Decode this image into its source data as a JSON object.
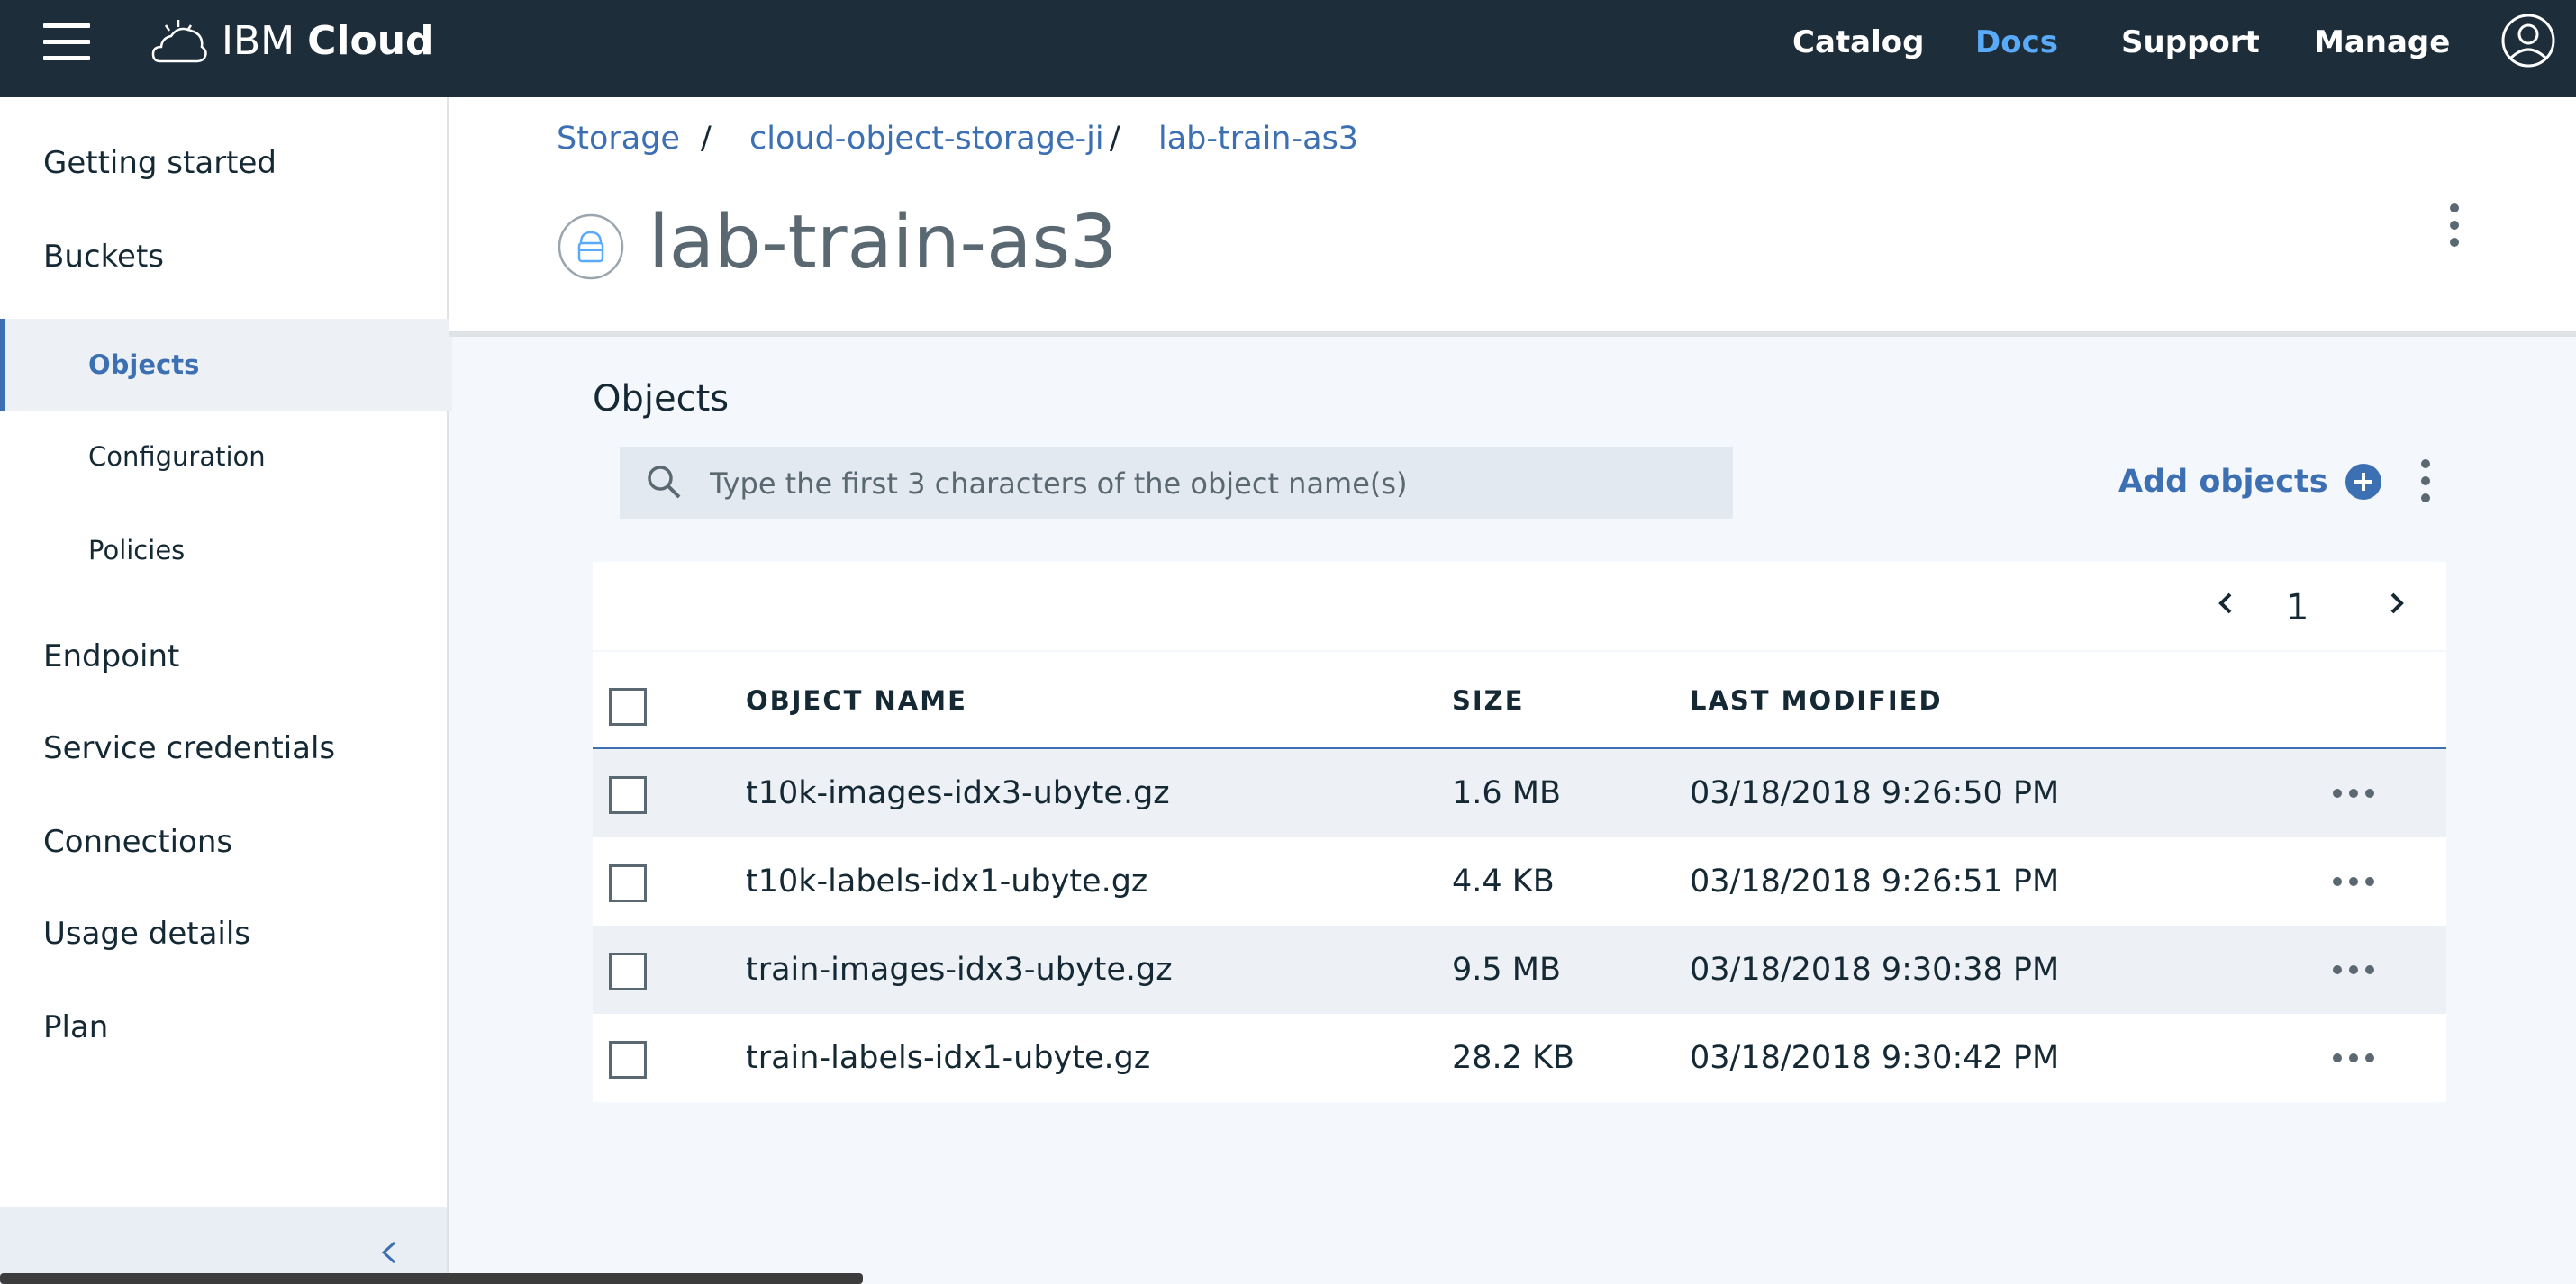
{
  "topbar": {
    "brand_prefix": "IBM",
    "brand_suffix": "Cloud",
    "nav": [
      {
        "label": "Catalog"
      },
      {
        "label": "Docs",
        "active": true
      },
      {
        "label": "Support"
      },
      {
        "label": "Manage"
      }
    ]
  },
  "sidebar": {
    "items": [
      {
        "label": "Getting started"
      },
      {
        "label": "Buckets"
      },
      {
        "label": "Objects",
        "active": true
      },
      {
        "label": "Configuration"
      },
      {
        "label": "Policies"
      },
      {
        "label": "Endpoint"
      },
      {
        "label": "Service credentials"
      },
      {
        "label": "Connections"
      },
      {
        "label": "Usage details"
      },
      {
        "label": "Plan"
      }
    ]
  },
  "breadcrumb": {
    "items": [
      "Storage",
      "cloud-object-storage-ji",
      "lab-train-as3"
    ],
    "separator": "/"
  },
  "page": {
    "title": "lab-train-as3"
  },
  "objects": {
    "section_title": "Objects",
    "search_placeholder": "Type the first 3 characters of the object name(s)",
    "search_value": "",
    "add_label": "Add objects",
    "page_number": "1",
    "columns": [
      "OBJECT NAME",
      "SIZE",
      "LAST MODIFIED"
    ],
    "rows": [
      {
        "name": "t10k-images-idx3-ubyte.gz",
        "size": "1.6 MB",
        "modified": "03/18/2018 9:26:50 PM"
      },
      {
        "name": "t10k-labels-idx1-ubyte.gz",
        "size": "4.4 KB",
        "modified": "03/18/2018 9:26:51 PM"
      },
      {
        "name": "train-images-idx3-ubyte.gz",
        "size": "9.5 MB",
        "modified": "03/18/2018 9:30:38 PM"
      },
      {
        "name": "train-labels-idx1-ubyte.gz",
        "size": "28.2 KB",
        "modified": "03/18/2018 9:30:42 PM"
      }
    ]
  },
  "colors": {
    "topbar_bg": "#1d2d3a",
    "accent": "#3d70b2",
    "active_nav": "#5aaafa"
  }
}
